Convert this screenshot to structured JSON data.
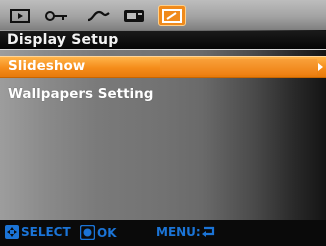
{
  "mode_tabs": [
    {
      "icon": "playback-icon"
    },
    {
      "icon": "key-icon"
    },
    {
      "icon": "curve-icon"
    },
    {
      "icon": "camera-card-icon"
    },
    {
      "icon": "display-settings-icon",
      "active": true
    }
  ],
  "title": "Display Setup",
  "menu": {
    "items": [
      {
        "label": "Slideshow",
        "selected": true
      },
      {
        "label": "Wallpapers Setting",
        "selected": false
      }
    ]
  },
  "footer": {
    "select_label": "SELECT",
    "ok_label": "OK",
    "menu_label": "MENU:"
  },
  "colors": {
    "accent": "#f58c1a",
    "footer_text": "#1b74d6"
  }
}
